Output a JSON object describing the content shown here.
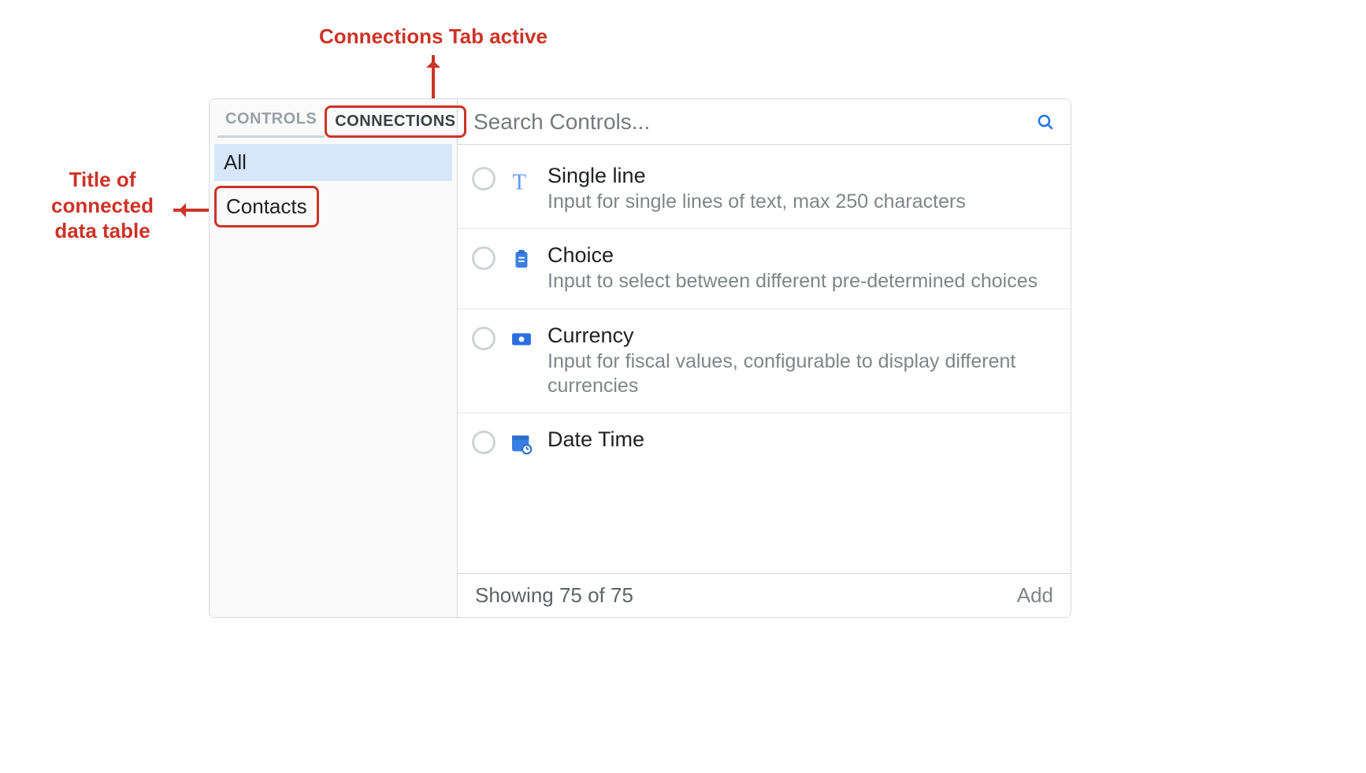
{
  "annotations": {
    "top": "Connections Tab active",
    "left": "Title of connected data table"
  },
  "sidebar": {
    "tabs": [
      {
        "label": "CONTROLS",
        "active": false
      },
      {
        "label": "CONNECTIONS",
        "active": true
      }
    ],
    "items": [
      {
        "label": "All",
        "selected": true
      },
      {
        "label": "Contacts",
        "selected": false
      }
    ]
  },
  "search": {
    "placeholder": "Search Controls..."
  },
  "controls": [
    {
      "title": "Single line",
      "desc": "Input for single lines of text, max 250 characters",
      "icon": "text-icon"
    },
    {
      "title": "Choice",
      "desc": "Input to select between different pre-determined choices",
      "icon": "clipboard-check-icon"
    },
    {
      "title": "Currency",
      "desc": "Input for fiscal values, configurable to display different currencies",
      "icon": "currency-icon"
    },
    {
      "title": "Date Time",
      "desc": "",
      "icon": "calendar-clock-icon"
    }
  ],
  "footer": {
    "status": "Showing 75 of 75",
    "add_label": "Add"
  }
}
